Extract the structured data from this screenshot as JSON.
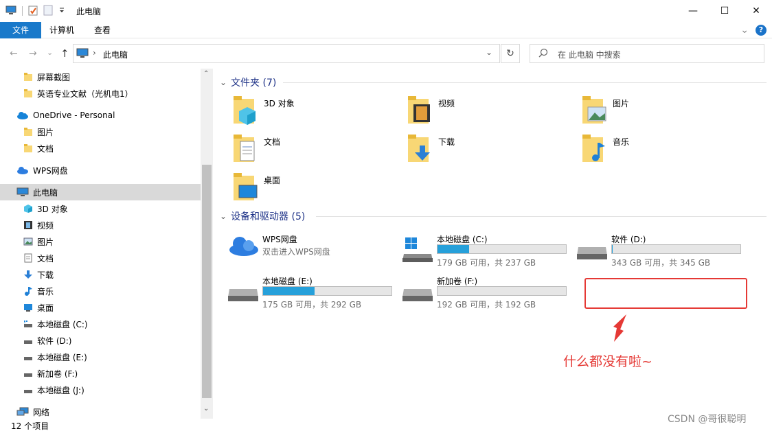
{
  "window": {
    "title": "此电脑",
    "minimize_glyph": "—",
    "maximize_glyph": "☐",
    "close_glyph": "✕"
  },
  "ribbon": {
    "tabs": [
      "文件",
      "计算机",
      "查看"
    ],
    "collapse_glyph": "⌄",
    "help_glyph": "?"
  },
  "address": {
    "path": "此电脑",
    "separator": "›",
    "search_placeholder": "在 此电脑 中搜索",
    "refresh_glyph": "↻",
    "back_glyph": "←",
    "forward_glyph": "→",
    "recent_glyph": "⌄",
    "up_glyph": "↑",
    "dropdown_glyph": "⌄"
  },
  "sidebar": {
    "items": [
      {
        "label": "屏幕截图",
        "icon": "folder-icon"
      },
      {
        "label": "英语专业文献（光机电1）",
        "icon": "folder-icon"
      },
      {
        "label": "OneDrive - Personal",
        "icon": "cloud-icon"
      },
      {
        "label": "图片",
        "icon": "folder-icon"
      },
      {
        "label": "文档",
        "icon": "folder-icon"
      },
      {
        "label": "WPS网盘",
        "icon": "wps-cloud-icon"
      },
      {
        "label": "此电脑",
        "icon": "this-pc-icon"
      },
      {
        "label": "3D 对象",
        "icon": "3d-objects-icon"
      },
      {
        "label": "视频",
        "icon": "video-icon"
      },
      {
        "label": "图片",
        "icon": "pictures-icon"
      },
      {
        "label": "文档",
        "icon": "documents-icon"
      },
      {
        "label": "下载",
        "icon": "download-icon"
      },
      {
        "label": "音乐",
        "icon": "music-icon"
      },
      {
        "label": "桌面",
        "icon": "desktop-icon"
      },
      {
        "label": "本地磁盘 (C:)",
        "icon": "drive-icon"
      },
      {
        "label": "软件 (D:)",
        "icon": "drive-icon"
      },
      {
        "label": "本地磁盘 (E:)",
        "icon": "drive-icon"
      },
      {
        "label": "新加卷 (F:)",
        "icon": "drive-icon"
      },
      {
        "label": "本地磁盘 (J:)",
        "icon": "drive-icon"
      },
      {
        "label": "网络",
        "icon": "network-icon"
      }
    ],
    "scroll_up_glyph": "⌃",
    "scroll_down_glyph": "⌄"
  },
  "folders_group": {
    "header": "文件夹 (7)",
    "chevron_glyph": "⌄",
    "items": [
      {
        "label": "3D 对象",
        "icon": "3d-objects-icon"
      },
      {
        "label": "视频",
        "icon": "video-icon"
      },
      {
        "label": "图片",
        "icon": "pictures-icon"
      },
      {
        "label": "文档",
        "icon": "documents-icon"
      },
      {
        "label": "下载",
        "icon": "download-icon"
      },
      {
        "label": "音乐",
        "icon": "music-icon"
      },
      {
        "label": "桌面",
        "icon": "desktop-icon"
      }
    ]
  },
  "devices_group": {
    "header": "设备和驱动器 (5)",
    "chevron_glyph": "⌄",
    "items": [
      {
        "name": "WPS网盘",
        "info": "双击进入WPS网盘",
        "icon": "wps-cloud-icon"
      },
      {
        "name": "本地磁盘 (C:)",
        "info": "179 GB 可用，共 237 GB",
        "used_fraction": 0.245,
        "icon": "drive-icon"
      },
      {
        "name": "软件 (D:)",
        "info": "343 GB 可用，共 345 GB",
        "used_fraction": 0.006,
        "icon": "drive-icon"
      },
      {
        "name": "本地磁盘 (E:)",
        "info": "175 GB 可用，共 292 GB",
        "used_fraction": 0.4,
        "icon": "drive-icon"
      },
      {
        "name": "新加卷 (F:)",
        "info": "192 GB 可用，共 192 GB",
        "used_fraction": 0.0,
        "icon": "drive-icon"
      }
    ]
  },
  "statusbar": {
    "count": "12 个项目"
  },
  "annotation": {
    "note": "什么都没有啦~",
    "color": "#e53935"
  },
  "watermark": "CSDN @哥很聪明",
  "colors": {
    "accent": "#1979ca",
    "drive_bar": "#26a0da",
    "group_header": "#1e3287"
  }
}
